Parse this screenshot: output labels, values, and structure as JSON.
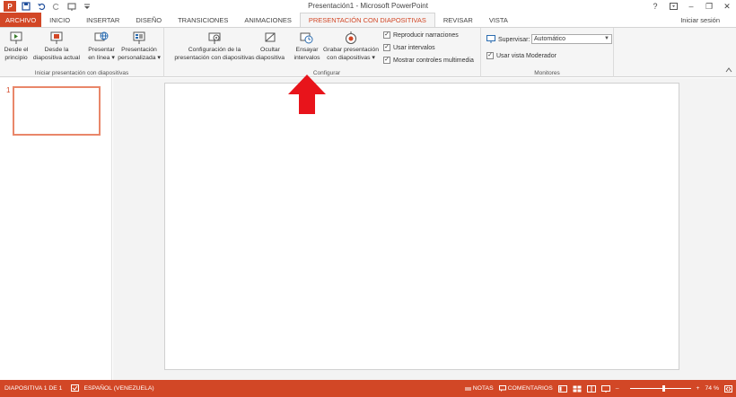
{
  "window": {
    "title": "Presentación1 - Microsoft PowerPoint",
    "app_badge": "P",
    "help": "?",
    "minimize": "–",
    "restore": "❐",
    "close": "✕"
  },
  "tabs": [
    {
      "label": "ARCHIVO"
    },
    {
      "label": "INICIO"
    },
    {
      "label": "INSERTAR"
    },
    {
      "label": "DISEÑO"
    },
    {
      "label": "TRANSICIONES"
    },
    {
      "label": "ANIMACIONES"
    },
    {
      "label": "PRESENTACIÓN CON DIAPOSITIVAS"
    },
    {
      "label": "REVISAR"
    },
    {
      "label": "VISTA"
    }
  ],
  "account": {
    "signin": "Iniciar sesión"
  },
  "ribbon": {
    "start": {
      "group_label": "Iniciar presentación con diapositivas",
      "from_start": [
        "Desde el",
        "principio"
      ],
      "from_current": [
        "Desde la",
        "diapositiva actual"
      ],
      "present_online": [
        "Presentar",
        "en línea ▾"
      ],
      "custom": [
        "Presentación",
        "personalizada ▾"
      ]
    },
    "setup": {
      "group_label": "Configurar",
      "setup_show": [
        "Configuración de la",
        "presentación con diapositivas"
      ],
      "hide_slide": [
        "Ocultar",
        "diapositiva"
      ],
      "rehearse": [
        "Ensayar",
        "intervalos"
      ],
      "record": [
        "Grabar presentación",
        "con diapositivas ▾"
      ],
      "play_narrations": "Reproducir narraciones",
      "use_timings": "Usar intervalos",
      "show_media_controls": "Mostrar controles multimedia"
    },
    "monitors": {
      "group_label": "Monitores",
      "monitor_label": "Supervisar:",
      "monitor_value": "Automático",
      "presenter_view": "Usar vista Moderador"
    }
  },
  "thumbnails": {
    "slide_number": "1"
  },
  "status": {
    "slide_info": "DIAPOSITIVA 1 DE 1",
    "language": "ESPAÑOL (VENEZUELA)",
    "notes": "NOTAS",
    "comments": "COMENTARIOS",
    "zoom_minus": "–",
    "zoom_plus": "+",
    "zoom_level": "74 %"
  },
  "colors": {
    "accent": "#d24726",
    "arrow": "#e8141b"
  }
}
